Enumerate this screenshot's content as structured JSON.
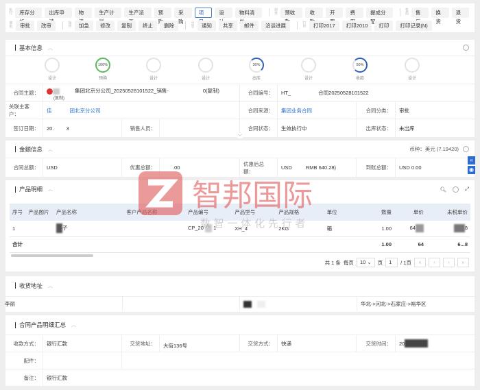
{
  "toolbar": {
    "groups": [
      {
        "label": "执行",
        "buttons": [
          "库存分析",
          "出库申请",
          "物流",
          "生产计划",
          "生产派工",
          "预购",
          "采购",
          "项目",
          "设计",
          "物料清单"
        ],
        "active": "项目"
      },
      {
        "label": "财务",
        "buttons": [
          "预收款",
          "收款",
          "开票",
          "费用",
          "提成分配"
        ]
      },
      {
        "label": "售后",
        "buttons": [
          "售后",
          "换货",
          "退货"
        ]
      },
      {
        "label": "审批",
        "buttons": [
          "审批",
          "改审"
        ]
      },
      {
        "label": "操作",
        "buttons": [
          "加急",
          "修改",
          "复制",
          "终止",
          "删除"
        ]
      },
      {
        "label": "分享",
        "buttons": [
          "通知",
          "共享",
          "邮件",
          "洽谈进展"
        ]
      },
      {
        "label": "打印",
        "buttons": [
          "打印2017",
          "打印2010",
          "打印",
          "打印记录(N)"
        ]
      }
    ]
  },
  "basic": {
    "title": "基本信息",
    "progress": [
      {
        "label": "设计",
        "value": 0,
        "text": ""
      },
      {
        "label": "预购",
        "value": 100,
        "text": "100%",
        "color": "#5cb85c"
      },
      {
        "label": "设计",
        "value": 0,
        "text": ""
      },
      {
        "label": "设计",
        "value": 0,
        "text": ""
      },
      {
        "label": "出库",
        "value": 30,
        "text": "30%",
        "color": "#2b5fb8"
      },
      {
        "label": "设计",
        "value": 0,
        "text": ""
      },
      {
        "label": "收款",
        "value": 50,
        "text": "50%",
        "color": "#2b5fb8"
      },
      {
        "label": "设计",
        "value": 0,
        "text": ""
      }
    ],
    "subject_label": "合同主题：",
    "subject_value": "集团北京分公司_20250528101522_销售-",
    "subject_suffix": "0(复制)",
    "subject_tag": "(复制)",
    "code_label": "合同编号：",
    "code_prefix": "HT_",
    "code_value": "合同20250528101522",
    "customer_label": "关联主客户：",
    "customer_prefix": "佳",
    "customer_value": "团北京分公司",
    "source_label": "合同来源：",
    "source_value": "集团业务合同",
    "category_label": "合同分类：",
    "category_value": "审批",
    "date_label": "签订日期：",
    "date_prefix": "20.",
    "date_suffix": "3",
    "sales_label": "销售人员：",
    "status_label": "合同状态：",
    "status_value": "生效执行中",
    "out_label": "出库状态：",
    "out_value": "未出库"
  },
  "amount": {
    "title": "金额信息",
    "currency_label": "币种：",
    "currency_value": "美元 (7.19420)",
    "total_label": "合同总额：",
    "total_value": "USD",
    "discount_label": "优惠总额：",
    "discount_value": ".00",
    "after_label": "优惠后总额：",
    "after_value": "USD",
    "after_rmb": "RMB 640.28)",
    "received_label": "到账总额：",
    "received_value": "USD 0.00"
  },
  "products": {
    "title": "产品明细",
    "columns": [
      "序号",
      "产品图片",
      "产品名称",
      "客户产品名称",
      "产品编号",
      "产品型号",
      "产品规格",
      "单位",
      "数量",
      "单价",
      "未税单价"
    ],
    "rows": [
      {
        "no": "1",
        "name": "子",
        "code": "CP_20",
        "code2": "1",
        "model": "XH_4",
        "spec": "2KG",
        "unit": "箱",
        "qty": "1.00",
        "price": "64",
        "untaxed": "8"
      }
    ],
    "total_label": "合计",
    "total_qty": "1.00",
    "total_price": "64",
    "total_untaxed": "6...8",
    "pager": {
      "total": "共 1 条",
      "per_page_label": "每页",
      "per_page": "10",
      "page_label": "页",
      "page": "1",
      "pages": "/ 1页"
    }
  },
  "address": {
    "title": "收货地址",
    "name": "李丽",
    "region": "华北->河北->石家庄->裕华区"
  },
  "summary": {
    "title": "合同产品明细汇总",
    "pay_label": "收款方式：",
    "pay_value": "银行汇款",
    "addr_label": "交货地址：",
    "addr_value": "大街136号",
    "ship_label": "交货方式：",
    "ship_value": "快递",
    "time_label": "交货时间：",
    "time_value": "20",
    "attach_label": "配件：",
    "note_label": "备注：",
    "note_value": "银行汇款"
  },
  "watermark": {
    "brand": "智邦国际",
    "slogan": "数 智 一 体 化 先 行 者"
  }
}
